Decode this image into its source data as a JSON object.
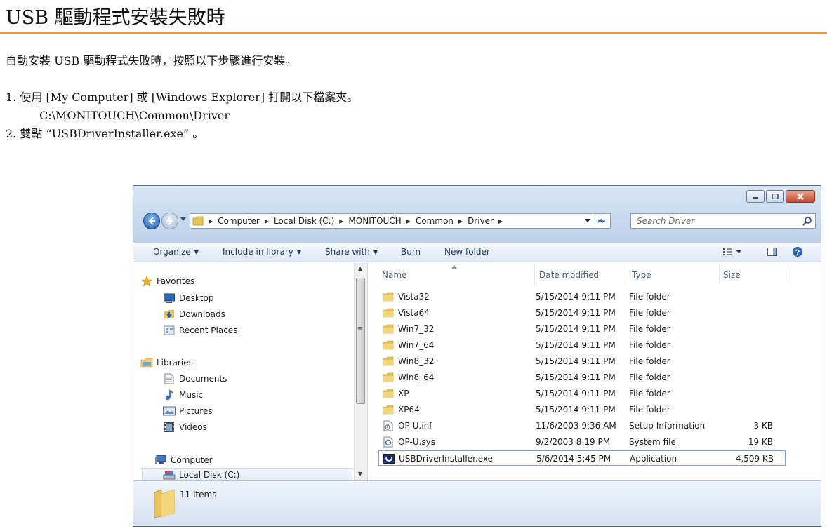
{
  "document": {
    "title": "USB 驅動程式安裝失敗時",
    "intro": "自動安裝 USB 驅動程式失敗時，按照以下步驟進行安裝。",
    "step1": "1. 使用 [My Computer] 或 [Windows Explorer] 打開以下檔案夾。",
    "step1_path": "C:\\MONITOUCH\\Common\\Driver",
    "step2": "2. 雙點 “USBDriverInstaller.exe” 。"
  },
  "colors": {
    "title_rule": "#e8a116",
    "window_frame": "#c4d6ec",
    "selection_border": "#7da2ce"
  },
  "explorer": {
    "breadcrumbs": [
      "Computer",
      "Local Disk (C:)",
      "MONITOUCH",
      "Common",
      "Driver"
    ],
    "search_placeholder": "Search Driver",
    "toolbar": {
      "organize": "Organize",
      "include_in_library": "Include in library",
      "share_with": "Share with",
      "burn": "Burn",
      "new_folder": "New folder"
    },
    "nav_pane": {
      "favorites": "Favorites",
      "desktop": "Desktop",
      "downloads": "Downloads",
      "recent_places": "Recent Places",
      "libraries": "Libraries",
      "documents": "Documents",
      "music": "Music",
      "pictures": "Pictures",
      "videos": "Videos",
      "computer": "Computer",
      "local_disk": "Local Disk (C:)"
    },
    "columns": {
      "name": "Name",
      "date_modified": "Date modified",
      "type": "Type",
      "size": "Size"
    },
    "files": [
      {
        "name": "Vista32",
        "date": "5/15/2014 9:11 PM",
        "type": "File folder",
        "size": "",
        "icon": "folder-icon"
      },
      {
        "name": "Vista64",
        "date": "5/15/2014 9:11 PM",
        "type": "File folder",
        "size": "",
        "icon": "folder-icon"
      },
      {
        "name": "Win7_32",
        "date": "5/15/2014 9:11 PM",
        "type": "File folder",
        "size": "",
        "icon": "folder-icon"
      },
      {
        "name": "Win7_64",
        "date": "5/15/2014 9:11 PM",
        "type": "File folder",
        "size": "",
        "icon": "folder-icon"
      },
      {
        "name": "Win8_32",
        "date": "5/15/2014 9:11 PM",
        "type": "File folder",
        "size": "",
        "icon": "folder-icon"
      },
      {
        "name": "Win8_64",
        "date": "5/15/2014 9:11 PM",
        "type": "File folder",
        "size": "",
        "icon": "folder-icon"
      },
      {
        "name": "XP",
        "date": "5/15/2014 9:11 PM",
        "type": "File folder",
        "size": "",
        "icon": "folder-icon"
      },
      {
        "name": "XP64",
        "date": "5/15/2014 9:11 PM",
        "type": "File folder",
        "size": "",
        "icon": "folder-icon"
      },
      {
        "name": "OP-U.inf",
        "date": "11/6/2003 9:36 AM",
        "type": "Setup Information",
        "size": "3 KB",
        "icon": "setup-info-icon"
      },
      {
        "name": "OP-U.sys",
        "date": "9/2/2003 8:19 PM",
        "type": "System file",
        "size": "19 KB",
        "icon": "system-file-icon"
      },
      {
        "name": "USBDriverInstaller.exe",
        "date": "5/6/2014 5:45 PM",
        "type": "Application",
        "size": "4,509 KB",
        "icon": "application-icon",
        "selected": true
      }
    ],
    "status": "11 items"
  }
}
